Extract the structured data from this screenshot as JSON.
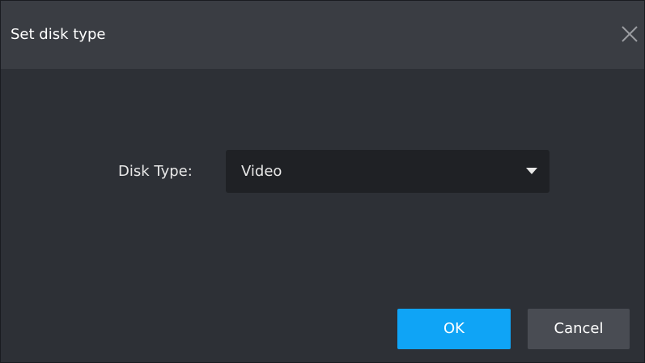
{
  "dialog": {
    "title": "Set disk type",
    "close_icon": "close-icon"
  },
  "form": {
    "disk_type_label": "Disk Type:",
    "disk_type_value": "Video",
    "dropdown_icon": "caret-down-icon"
  },
  "buttons": {
    "ok_label": "OK",
    "cancel_label": "Cancel"
  },
  "colors": {
    "background": "#2d3036",
    "titlebar": "#3a3d43",
    "select_bg": "#1f2125",
    "primary": "#0fa4f6",
    "secondary": "#494c53",
    "text": "#e8e8e8"
  }
}
